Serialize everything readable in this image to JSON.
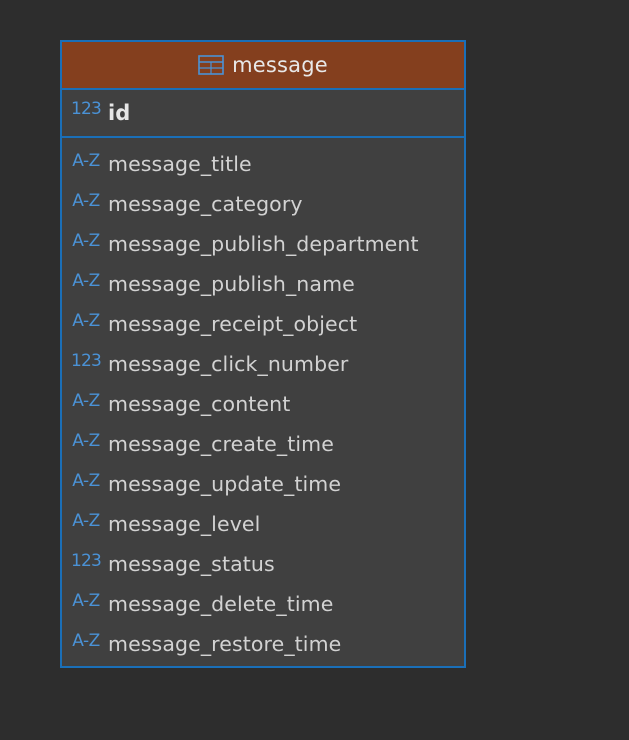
{
  "entity": {
    "title": "message",
    "icon": "table-icon",
    "primary_key": {
      "type_label": "123",
      "type_icon": "numeric-type-icon",
      "name": "id"
    },
    "attributes": [
      {
        "type_label": "A-Z",
        "type_icon": "text-type-icon",
        "name": "message_title"
      },
      {
        "type_label": "A-Z",
        "type_icon": "text-type-icon",
        "name": "message_category"
      },
      {
        "type_label": "A-Z",
        "type_icon": "text-type-icon",
        "name": "message_publish_department"
      },
      {
        "type_label": "A-Z",
        "type_icon": "text-type-icon",
        "name": "message_publish_name"
      },
      {
        "type_label": "A-Z",
        "type_icon": "text-type-icon",
        "name": "message_receipt_object"
      },
      {
        "type_label": "123",
        "type_icon": "numeric-type-icon",
        "name": "message_click_number"
      },
      {
        "type_label": "A-Z",
        "type_icon": "text-type-icon",
        "name": "message_content"
      },
      {
        "type_label": "A-Z",
        "type_icon": "text-type-icon",
        "name": "message_create_time"
      },
      {
        "type_label": "A-Z",
        "type_icon": "text-type-icon",
        "name": "message_update_time"
      },
      {
        "type_label": "A-Z",
        "type_icon": "text-type-icon",
        "name": "message_level"
      },
      {
        "type_label": "123",
        "type_icon": "numeric-type-icon",
        "name": "message_status"
      },
      {
        "type_label": "A-Z",
        "type_icon": "text-type-icon",
        "name": "message_delete_time"
      },
      {
        "type_label": "A-Z",
        "type_icon": "text-type-icon",
        "name": "message_restore_time"
      }
    ]
  },
  "colors": {
    "background": "#2d2d2d",
    "entity_body": "#404040",
    "entity_header": "#843f1e",
    "border": "#1a6fb8",
    "type_icon": "#4a92d6",
    "text": "#d2d2d2"
  }
}
